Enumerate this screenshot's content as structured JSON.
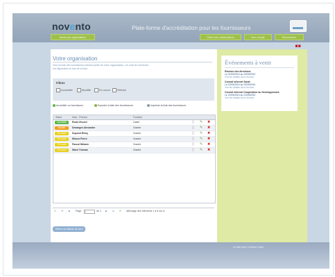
{
  "header": {
    "logo_prefix": "nov",
    "logo_accent": "e",
    "logo_suffix": "nto",
    "platform_title": "Plate-forme d'accréditation pour les fournisseurs",
    "nav_left": "Accès aux organisations",
    "nav_right": [
      "Gérer mes collaborateurs",
      "Mon compte",
      "Déconnexion"
    ],
    "flags": "▆ ▆"
  },
  "main": {
    "title": "Votre organisation",
    "intro": "Voici la liste des fournisseurs faisant partie de votre organisation. Un outil de recherche est disponible en bas de la liste.",
    "filters_title": "Filtres",
    "filters": [
      "Accrédité",
      "Modifié",
      "En cours",
      "Refusé"
    ],
    "actions": [
      "Accréditer un fournisseur",
      "Exporter la liste des fournisseurs",
      "Imprimer la liste des fournisseurs"
    ],
    "table": {
      "headers": [
        "Statut",
        "Nom - Prénom",
        "Fonction"
      ],
      "rows": [
        {
          "status": "Accrédité",
          "status_color": "#5cb84a",
          "name": "Roda Vincent",
          "role": "Cadre"
        },
        {
          "status": "Modifié",
          "status_color": "#f0a020",
          "name": "Desanges Alexandre",
          "role": "Ouvrier"
        },
        {
          "status": "En cours",
          "status_color": "#e8d020",
          "name": "Dupond Rémy",
          "role": "Ouvrier"
        },
        {
          "status": "En cours",
          "status_color": "#e8d020",
          "name": "Mineur Pierre",
          "role": "Ouvrier"
        },
        {
          "status": "En cours",
          "status_color": "#e8d020",
          "name": "Pascal Mélanie",
          "role": "Ouvrier"
        },
        {
          "status": "En cours",
          "status_color": "#e8d020",
          "name": "Wack Thomas",
          "role": "Ouvrier"
        }
      ]
    },
    "pager": {
      "page_label": "Page",
      "page_value": "1",
      "of_label": "de 1",
      "summary": "Affichage des éléments 1 à 6 sur 6"
    },
    "back_button": "Retour au tableau de bord"
  },
  "events": {
    "title": "Événements à venir",
    "items": [
      {
        "title": "Réunion des directions",
        "date": "Le 21/05/2010 au 23/05/2010",
        "link": "Voir les détails de la réunion"
      },
      {
        "title": "Conseil informel Santé",
        "date": "Le 21/05/2010 au 23/05/2010",
        "link": "Voir les détails de la réunion"
      },
      {
        "title": "Conseil informel Coopération au Développement",
        "date": "Le 21/05/2010 au 21/05/2010",
        "link": "Voir les détails de la réunion"
      }
    ]
  },
  "footer": {
    "credit": "Un site web",
    "links": "| Contact | Aide"
  }
}
